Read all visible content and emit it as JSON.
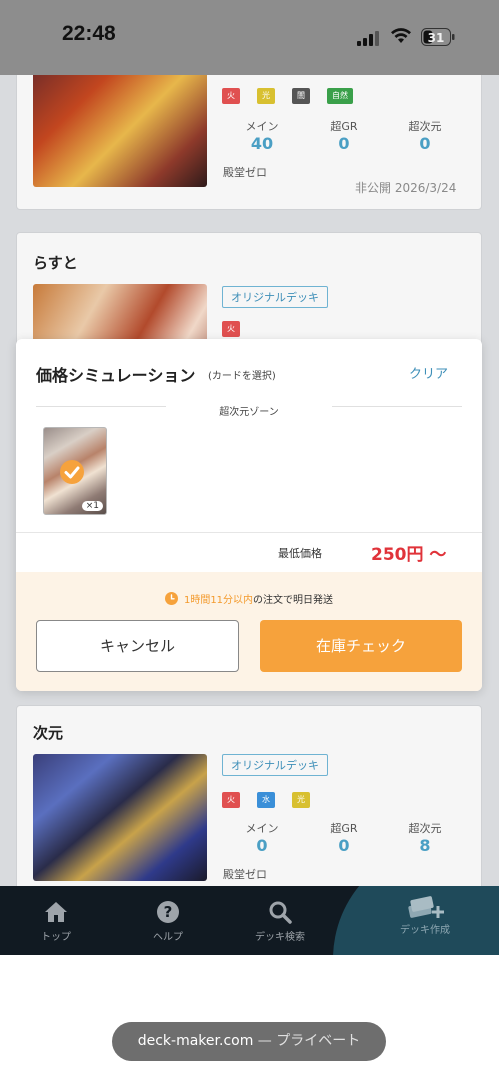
{
  "status_bar": {
    "time": "22:48",
    "battery": "31"
  },
  "decks": [
    {
      "civilizations": [
        {
          "label": "火",
          "color": "#e05050"
        },
        {
          "label": "光",
          "color": "#d8c030"
        },
        {
          "label": "闇",
          "color": "#555555"
        },
        {
          "label": "自然",
          "color": "#3aa04a"
        }
      ],
      "stats": [
        {
          "label": "メイン",
          "value": "40"
        },
        {
          "label": "超GR",
          "value": "0"
        },
        {
          "label": "超次元",
          "value": "0"
        }
      ],
      "hall": "殿堂ゼロ",
      "visibility_date": "非公開 2026/3/24"
    },
    {
      "name": "らすと",
      "badge": "オリジナルデッキ",
      "civilizations": [
        {
          "label": "火",
          "color": "#e05050"
        }
      ]
    },
    {
      "name": "次元",
      "badge": "オリジナルデッキ",
      "civilizations": [
        {
          "label": "火",
          "color": "#e05050"
        },
        {
          "label": "水",
          "color": "#3a8fd8"
        },
        {
          "label": "光",
          "color": "#d8c030"
        }
      ],
      "stats": [
        {
          "label": "メイン",
          "value": "0"
        },
        {
          "label": "超GR",
          "value": "0"
        },
        {
          "label": "超次元",
          "value": "8"
        }
      ],
      "hall": "殿堂ゼロ"
    }
  ],
  "modal": {
    "title": "価格シミュレーション",
    "subtitle": "(カードを選択)",
    "clear": "クリア",
    "zone": "超次元ゾーン",
    "card_qty": "×1",
    "min_price_label": "最低価格",
    "min_price": "250円 〜",
    "shipping_highlight": "1時間11分以内",
    "shipping_rest": "の注文で明日発送",
    "cancel": "キャンセル",
    "stock_check": "在庫チェック"
  },
  "bottom_nav": [
    {
      "label": "トップ",
      "icon": "home-icon"
    },
    {
      "label": "ヘルプ",
      "icon": "help-icon"
    },
    {
      "label": "デッキ検索",
      "icon": "search-icon"
    },
    {
      "label": "デッキ作成",
      "icon": "deck-create-icon"
    }
  ],
  "browser": {
    "domain": "deck-maker.com",
    "mode": " — プライベート"
  }
}
